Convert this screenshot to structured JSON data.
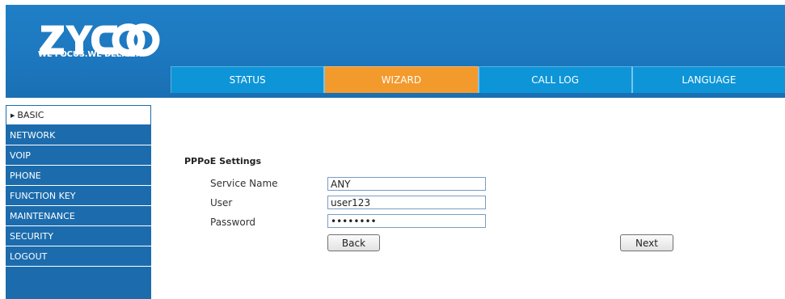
{
  "header": {
    "logo_text": "ZYCOO",
    "tagline": "WE FOCUS.WE DELIVER"
  },
  "nav": {
    "tabs": [
      {
        "label": "STATUS",
        "active": false
      },
      {
        "label": "WIZARD",
        "active": true
      },
      {
        "label": "CALL LOG",
        "active": false
      },
      {
        "label": "LANGUAGE",
        "active": false
      }
    ]
  },
  "sidebar": {
    "items": [
      {
        "label": "BASIC",
        "active": true
      },
      {
        "label": "NETWORK",
        "active": false
      },
      {
        "label": "VOIP",
        "active": false
      },
      {
        "label": "PHONE",
        "active": false
      },
      {
        "label": "FUNCTION KEY",
        "active": false
      },
      {
        "label": "MAINTENANCE",
        "active": false
      },
      {
        "label": "SECURITY",
        "active": false
      },
      {
        "label": "LOGOUT",
        "active": false
      }
    ]
  },
  "form": {
    "title": "PPPoE Settings",
    "fields": [
      {
        "label": "Service Name",
        "value": "ANY",
        "type": "text"
      },
      {
        "label": "User",
        "value": "user123",
        "type": "text"
      },
      {
        "label": "Password",
        "value": "password",
        "type": "password"
      }
    ],
    "back_label": "Back",
    "next_label": "Next"
  },
  "colors": {
    "header_blue": "#1d78bf",
    "tab_blue": "#0d95d8",
    "tab_active_orange": "#f39a2c",
    "sidebar_blue": "#1c6cad"
  }
}
